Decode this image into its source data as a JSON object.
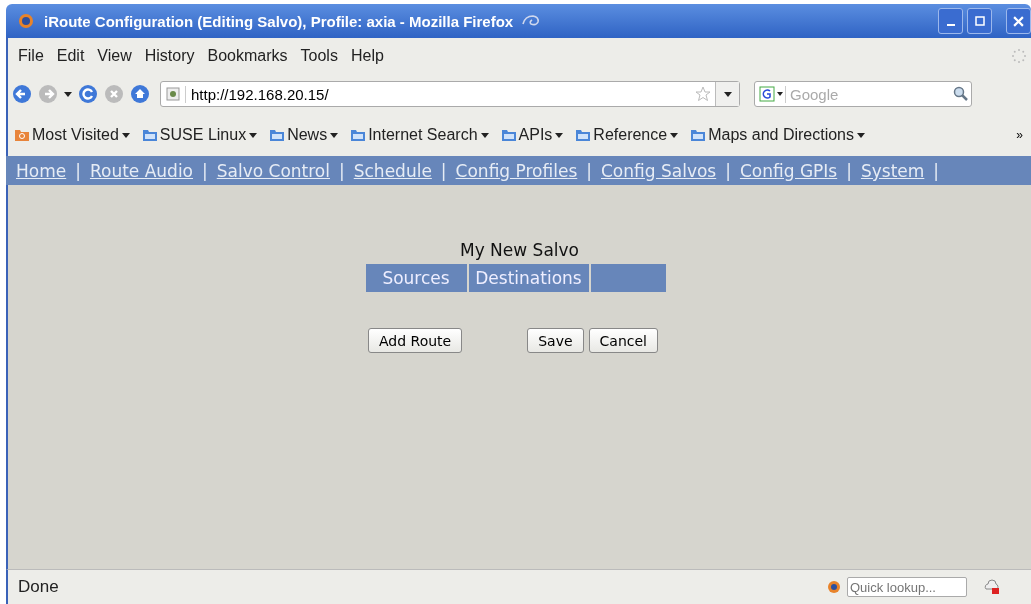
{
  "window": {
    "title": "iRoute Configuration (Editing Salvo), Profile: axia - Mozilla Firefox"
  },
  "menu": [
    "File",
    "Edit",
    "View",
    "History",
    "Bookmarks",
    "Tools",
    "Help"
  ],
  "url": "http://192.168.20.15/",
  "search": {
    "placeholder": "Google"
  },
  "bookmarks": [
    {
      "label": "Most Visited",
      "kind": "smart"
    },
    {
      "label": "SUSE Linux",
      "kind": "folder"
    },
    {
      "label": "News",
      "kind": "folder"
    },
    {
      "label": "Internet Search",
      "kind": "folder"
    },
    {
      "label": "APIs",
      "kind": "folder"
    },
    {
      "label": "Reference",
      "kind": "folder"
    },
    {
      "label": "Maps and Directions",
      "kind": "folder"
    }
  ],
  "overflow": "»",
  "site_nav": {
    "links": [
      "Home",
      "Route Audio",
      "Salvo Control",
      "Schedule",
      "Config Profiles",
      "Config Salvos",
      "Config GPIs",
      "System"
    ],
    "separator": "|"
  },
  "salvo": {
    "title": "My New Salvo",
    "columns": [
      "Sources",
      "Destinations"
    ]
  },
  "buttons": {
    "add": "Add Route",
    "save": "Save",
    "cancel": "Cancel"
  },
  "status_bar": {
    "text": "Done",
    "lookup_placeholder": "Quick lookup..."
  }
}
